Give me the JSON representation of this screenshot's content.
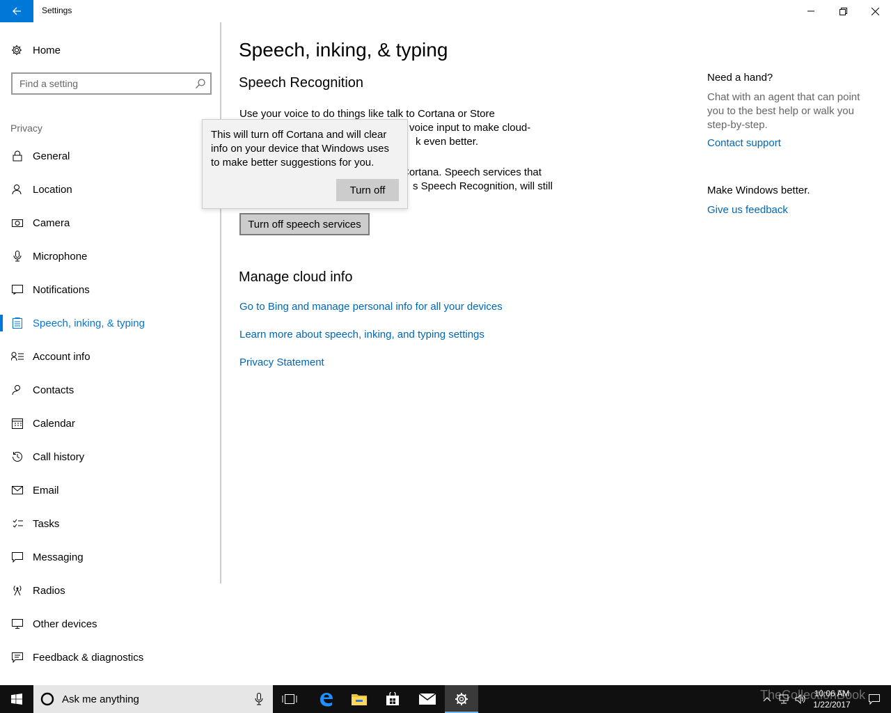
{
  "window": {
    "title": "Settings"
  },
  "sidebar": {
    "home_label": "Home",
    "search_placeholder": "Find a setting",
    "section_label": "Privacy",
    "items": [
      {
        "label": "General",
        "icon": "lock-icon"
      },
      {
        "label": "Location",
        "icon": "person-location-icon"
      },
      {
        "label": "Camera",
        "icon": "camera-icon"
      },
      {
        "label": "Microphone",
        "icon": "microphone-icon"
      },
      {
        "label": "Notifications",
        "icon": "notification-icon"
      },
      {
        "label": "Speech, inking, & typing",
        "icon": "clipboard-icon",
        "active": true
      },
      {
        "label": "Account info",
        "icon": "account-info-icon"
      },
      {
        "label": "Contacts",
        "icon": "contacts-icon"
      },
      {
        "label": "Calendar",
        "icon": "calendar-icon"
      },
      {
        "label": "Call history",
        "icon": "history-icon"
      },
      {
        "label": "Email",
        "icon": "mail-icon"
      },
      {
        "label": "Tasks",
        "icon": "tasks-icon"
      },
      {
        "label": "Messaging",
        "icon": "message-icon"
      },
      {
        "label": "Radios",
        "icon": "radio-tower-icon"
      },
      {
        "label": "Other devices",
        "icon": "devices-icon"
      },
      {
        "label": "Feedback & diagnostics",
        "icon": "feedback-icon"
      }
    ]
  },
  "main": {
    "page_title": "Speech, inking, & typing",
    "speech_heading": "Speech Recognition",
    "para1_line1": "Use your voice to do things like talk to Cortana or Store",
    "para1_line2": "voice input to make cloud-",
    "para1_line3": "k even better.",
    "para2_line1": "Cortana. Speech services that",
    "para2_line2": "s Speech Recognition, will still",
    "speech_button": "Turn off speech services",
    "cloud_heading": "Manage cloud info",
    "links": [
      "Go to Bing and manage personal info for all your devices",
      "Learn more about speech, inking, and typing settings",
      "Privacy Statement"
    ]
  },
  "flyout": {
    "text": "This will turn off Cortana and will clear info on your device that Windows uses to make better suggestions for you.",
    "button": "Turn off"
  },
  "right_pane": {
    "help_heading": "Need a hand?",
    "help_text": "Chat with an agent that can point you to the best help or walk you step-by-step.",
    "help_link": "Contact support",
    "feedback_heading": "Make Windows better.",
    "feedback_link": "Give us feedback"
  },
  "taskbar": {
    "search_placeholder": "Ask me anything",
    "time": "10:06 AM",
    "date": "1/22/2017",
    "watermark": "TheCollectionBook"
  },
  "colors": {
    "accent": "#0078d7",
    "link": "#0067b8",
    "taskbar": "#101010"
  }
}
